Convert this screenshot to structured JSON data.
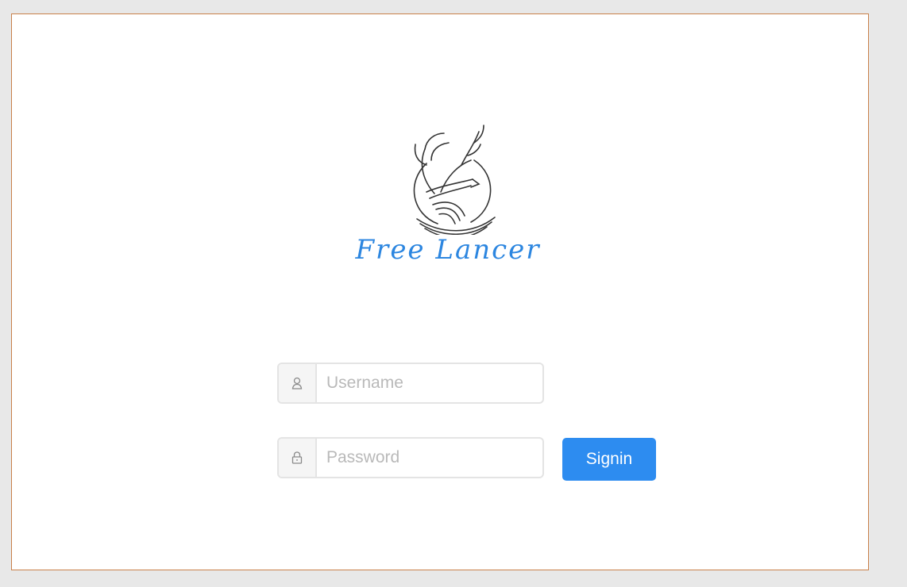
{
  "brand": {
    "name": "Free Lancer",
    "logo_icon": "deer-head-logo-icon",
    "color": "#2c86e0"
  },
  "login_form": {
    "username": {
      "icon": "user-icon",
      "placeholder": "Username",
      "value": ""
    },
    "password": {
      "icon": "lock-icon",
      "placeholder": "Password",
      "value": ""
    },
    "signin_label": "Signin",
    "signin_color": "#2d8cf0"
  },
  "theme": {
    "frame_border": "#c9804a",
    "page_background": "#e8e8e8"
  }
}
